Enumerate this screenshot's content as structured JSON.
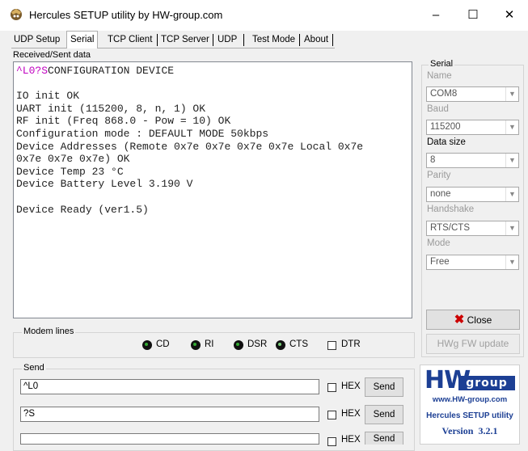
{
  "window": {
    "title": "Hercules SETUP utility by HW-group.com",
    "minimize": "–",
    "maximize": "☐",
    "close": "✕"
  },
  "tabs": [
    "UDP Setup",
    "Serial",
    "TCP Client",
    "TCP Server",
    "UDP",
    "Test Mode",
    "About"
  ],
  "active_tab": "Serial",
  "received": {
    "label": "Received/Sent data",
    "prefix": "^L0?S",
    "first_line_rest": "CONFIGURATION DEVICE",
    "lines": [
      "",
      "IO init OK",
      "UART init (115200, 8, n, 1) OK",
      "RF init (Freq 868.0 - Pow = 10) OK",
      "Configuration mode : DEFAULT MODE 50kbps",
      "Device Addresses (Remote 0x7e 0x7e 0x7e 0x7e Local 0x7e",
      "0x7e 0x7e 0x7e) OK",
      "Device Temp 23 °C",
      "Device Battery Level 3.190 V",
      "",
      "Device Ready (ver1.5)"
    ]
  },
  "serial": {
    "group_label": "Serial",
    "name_label": "Name",
    "name_value": "COM8",
    "baud_label": "Baud",
    "baud_value": "115200",
    "datasize_label": "Data size",
    "datasize_value": "8",
    "parity_label": "Parity",
    "parity_value": "none",
    "handshake_label": "Handshake",
    "handshake_value": "RTS/CTS",
    "mode_label": "Mode",
    "mode_value": "Free",
    "close_button": "Close",
    "fw_button": "HWg FW update"
  },
  "modem": {
    "group_label": "Modem lines",
    "cd": "CD",
    "ri": "RI",
    "dsr": "DSR",
    "cts": "CTS",
    "dtr": "DTR"
  },
  "send": {
    "group_label": "Send",
    "rows": [
      {
        "value": "^L0",
        "hex": "HEX",
        "button": "Send"
      },
      {
        "value": "?S",
        "hex": "HEX",
        "button": "Send"
      },
      {
        "value": "",
        "hex": "HEX",
        "button": "Send"
      }
    ]
  },
  "logo": {
    "brand_hw": "HW",
    "brand_group": "group",
    "url": "www.HW-group.com",
    "product": "Hercules SETUP utility",
    "version": "Version  3.2.1"
  },
  "colors": {
    "magenta_prefix": "#c000c0",
    "close_x": "#cc0000",
    "logo_blue": "#1c3f94"
  }
}
